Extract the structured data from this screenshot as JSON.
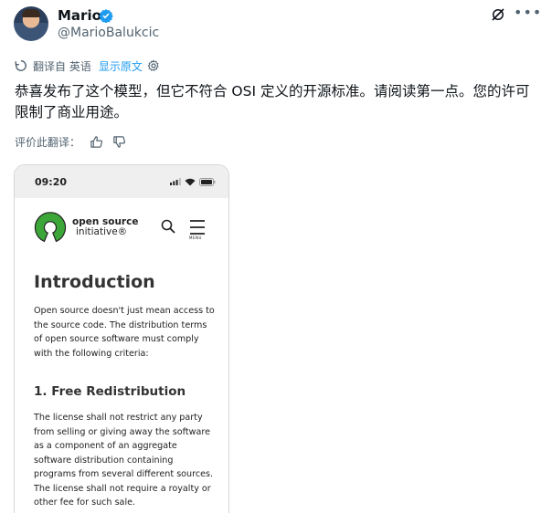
{
  "author": {
    "name": "Mario",
    "handle": "@MarioBalukcic"
  },
  "translation": {
    "from_label": "翻译自 英语",
    "show_original": "显示原文"
  },
  "tweet": {
    "text": "恭喜发布了这个模型，但它不符合 OSI 定义的开源标准。请阅读第一点。您的许可限制了商业用途。"
  },
  "rating": {
    "label": "评价此翻译："
  },
  "embedded_image": {
    "status_time": "09:20",
    "org_name_line1": "open source",
    "org_name_line2": "initiative®",
    "menu_label": "MENU",
    "intro_heading": "Introduction",
    "intro_text": "Open source doesn't just mean access to the source code. The distribution terms of open source software must comply with the following criteria:",
    "section1_heading": "1. Free Redistribution",
    "section1_text": "The license shall not restrict any party from selling or giving away the software as a component of an aggregate software distribution containing programs from several different sources. The license shall not require a royalty or other fee for such sale."
  },
  "colors": {
    "link": "#1d9bf0",
    "verified": "#1d9bf0",
    "osi_green": "#3da639",
    "muted": "#536471"
  }
}
